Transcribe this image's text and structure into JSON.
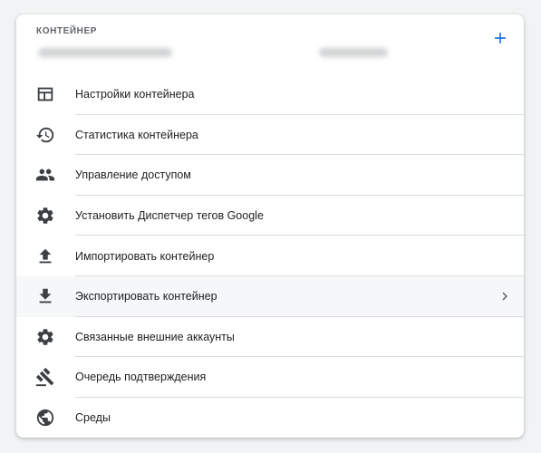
{
  "panel": {
    "section_label": "КОНТЕЙНЕР",
    "accent_color": "#1a73e8",
    "add_icon": "plus-icon"
  },
  "menu": {
    "items": [
      {
        "label": "Настройки контейнера",
        "icon": "settings-panel-icon"
      },
      {
        "label": "Статистика контейнера",
        "icon": "history-icon"
      },
      {
        "label": "Управление доступом",
        "icon": "people-icon"
      },
      {
        "label": "Установить Диспетчер тегов Google",
        "icon": "gear-icon"
      },
      {
        "label": "Импортировать контейнер",
        "icon": "upload-icon"
      },
      {
        "label": "Экспортировать контейнер",
        "icon": "download-icon",
        "selected": true,
        "has_submenu": true
      },
      {
        "label": "Связанные внешние аккаунты",
        "icon": "gear-icon"
      },
      {
        "label": "Очередь подтверждения",
        "icon": "gavel-icon"
      },
      {
        "label": "Среды",
        "icon": "globe-icon"
      }
    ]
  }
}
